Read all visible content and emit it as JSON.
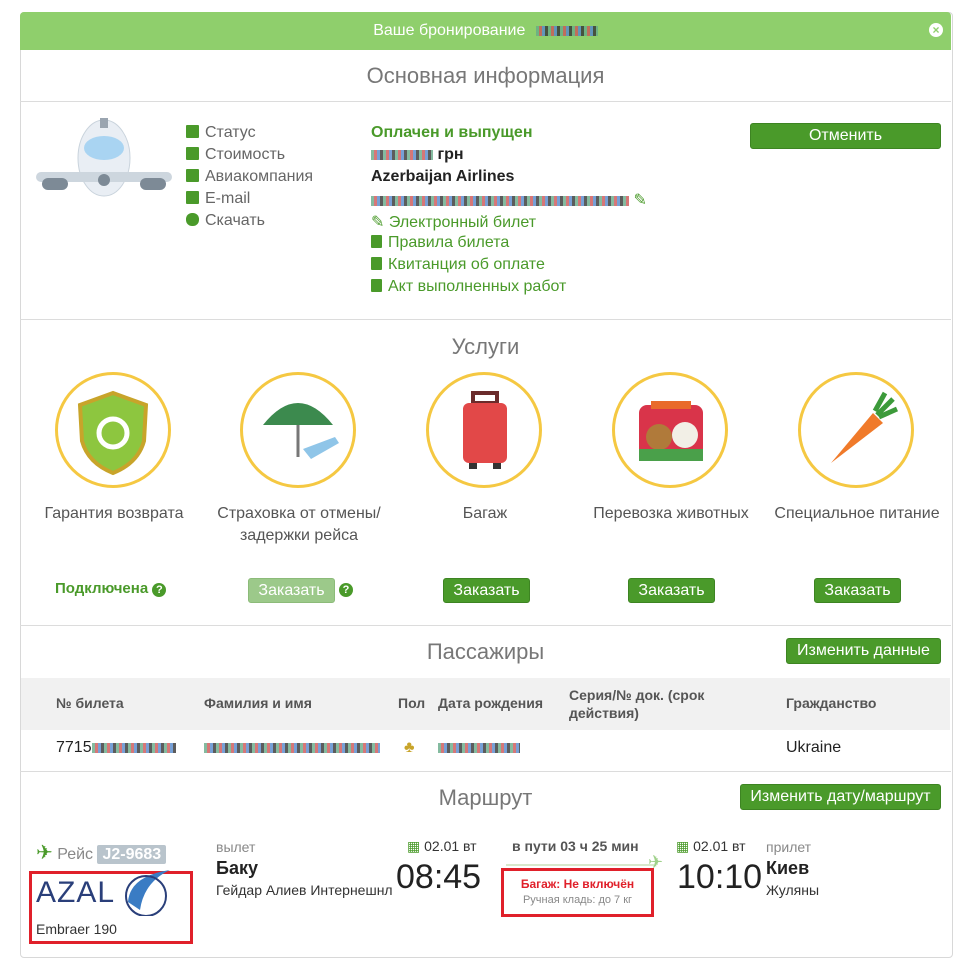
{
  "header": {
    "title": "Ваше бронирование",
    "close_icon": "close-icon"
  },
  "main_info": {
    "title": "Основная информация",
    "labels": {
      "status": "Статус",
      "cost": "Стоимость",
      "airline": "Авиакомпания",
      "email": "E-mail",
      "download": "Скачать"
    },
    "values": {
      "status": "Оплачен и выпущен",
      "currency": "грн",
      "airline": "Azerbaijan Airlines"
    },
    "links": {
      "eticket": "Электронный билет",
      "rules": "Правила билета",
      "receipt": "Квитанция об оплате",
      "act": "Акт выполненных работ"
    },
    "cancel_label": "Отменить"
  },
  "services": {
    "title": "Услуги",
    "items": [
      {
        "name": "Гарантия возврата",
        "status": "Подключена",
        "icon": "shield-refresh-icon"
      },
      {
        "name": "Страховка от отмены/задержки рейса",
        "action": "Заказать",
        "icon": "umbrella-plane-icon"
      },
      {
        "name": "Багаж",
        "action": "Заказать",
        "icon": "suitcase-icon"
      },
      {
        "name": "Перевозка животных",
        "action": "Заказать",
        "icon": "pet-carrier-icon"
      },
      {
        "name": "Специальное питание",
        "action": "Заказать",
        "icon": "carrot-icon"
      }
    ]
  },
  "passengers": {
    "title": "Пассажиры",
    "edit_label": "Изменить данные",
    "headers": [
      "№ билета",
      "Фамилия и имя",
      "Пол",
      "Дата рождения",
      "Серия/№ док. (срок действия)",
      "Гражданство"
    ],
    "rows": [
      {
        "ticket_prefix": "7715",
        "citizenship": "Ukraine"
      }
    ]
  },
  "route": {
    "title": "Маршрут",
    "edit_label": "Изменить дату/маршрут",
    "flight_label": "Рейс",
    "flight_number": "J2-9683",
    "airline_logo": "AZAL",
    "aircraft": "Embraer 190",
    "departure": {
      "label": "вылет",
      "city": "Баку",
      "airport": "Гейдар Алиев Интернешнл",
      "date": "02.01 вт",
      "time": "08:45"
    },
    "duration": "в пути 03 ч 25 мин",
    "baggage": "Багаж: Не включён",
    "hand_luggage": "Ручная кладь: до 7 кг",
    "arrival": {
      "label": "прилет",
      "city": "Киев",
      "airport": "Жуляны",
      "date": "02.01 вт",
      "time": "10:10"
    }
  },
  "colors": {
    "accent": "#4a9a2a",
    "header": "#8fcf6c",
    "highlight": "#e0202a",
    "circle": "#f5c842"
  }
}
